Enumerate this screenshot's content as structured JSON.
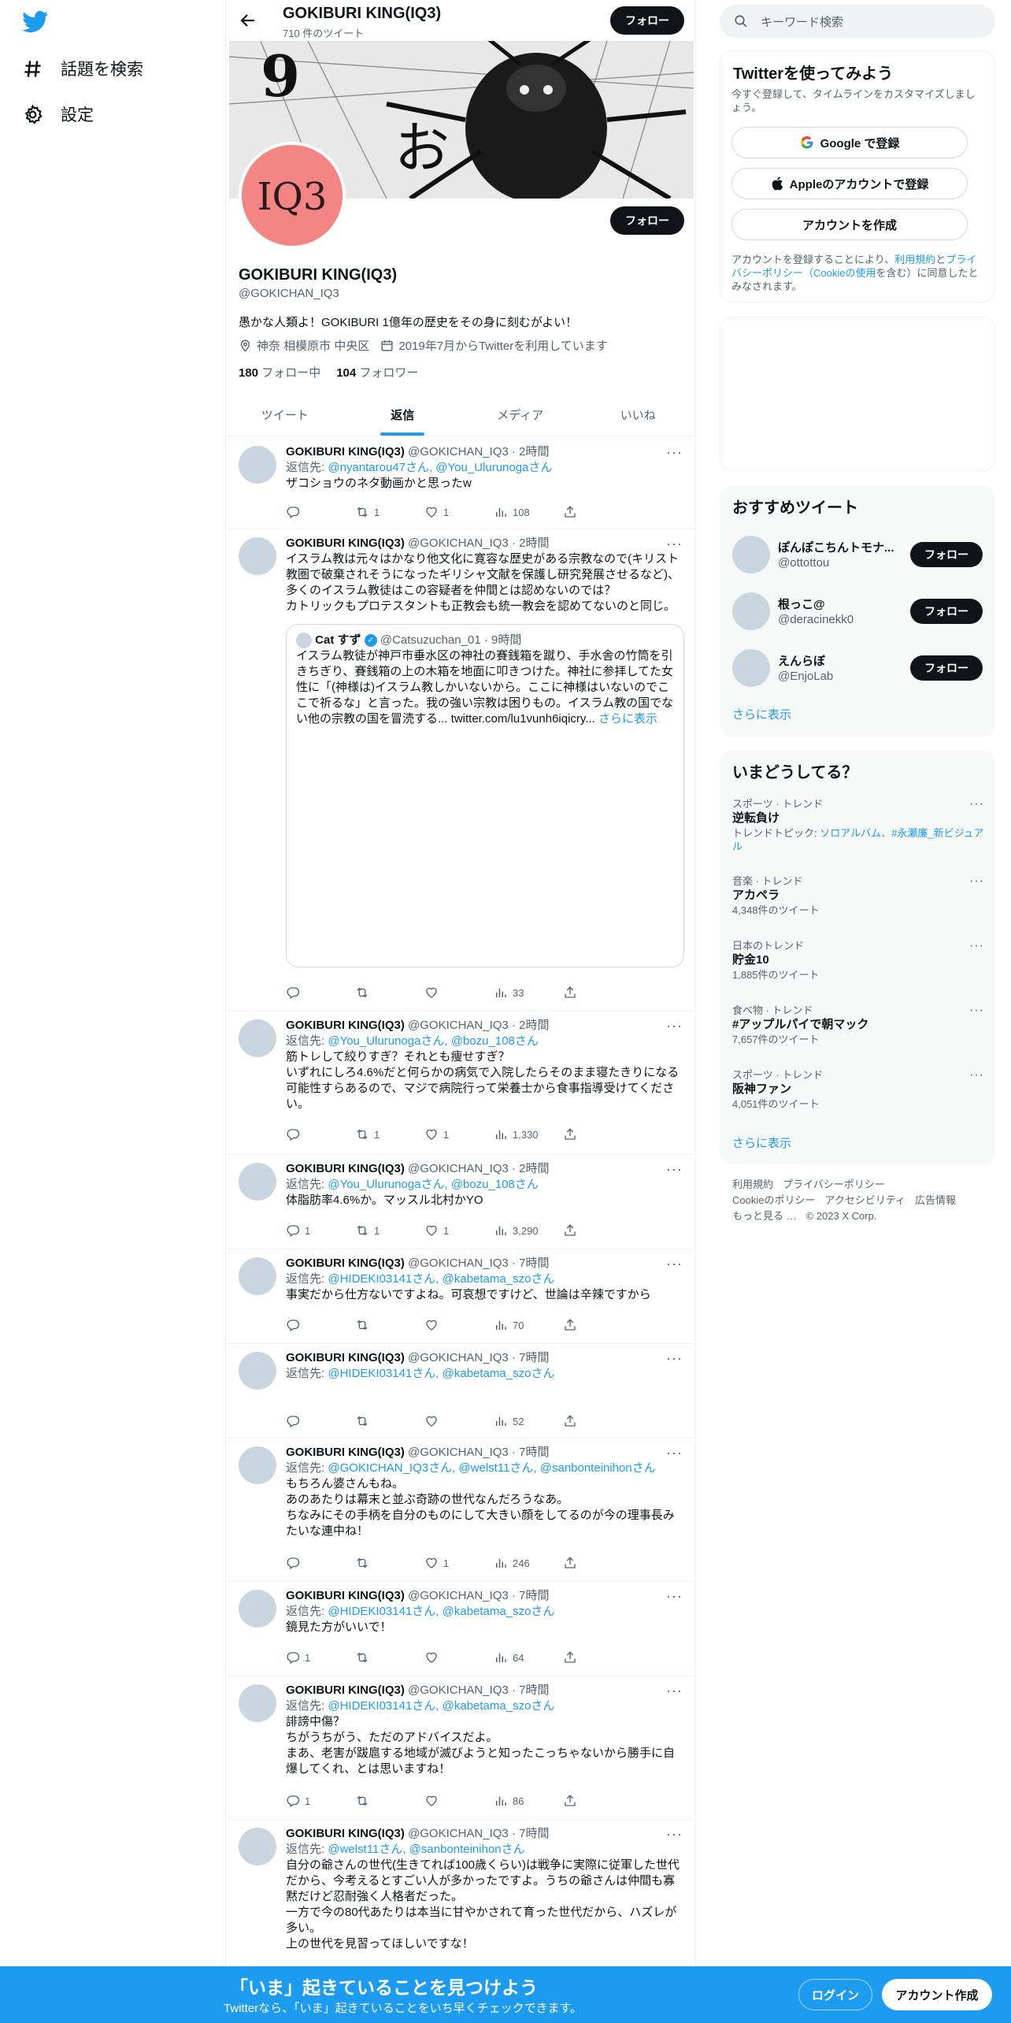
{
  "nav": {
    "explore_label": "話題を検索",
    "settings_label": "設定"
  },
  "header": {
    "title": "GOKIBURI KING(IQ3)",
    "tweet_count": "710 件のツイート",
    "follow_label": "フォロー"
  },
  "profile": {
    "avatar_text": "IQ3",
    "name": "GOKIBURI KING(IQ3)",
    "handle": "@GOKICHAN_IQ3",
    "bio": "愚かな人類よ！GOKIBURI 1億年の歴史をその身に刻むがよい！",
    "location": "神奈 相模原市 中央区",
    "joined": "2019年7月からTwitterを利用しています",
    "following_count": "180",
    "following_label": "フォロー中",
    "followers_count": "104",
    "followers_label": "フォロワー",
    "follow_label": "フォロー"
  },
  "tabs": [
    "ツイート",
    "返信",
    "メディア",
    "いいね"
  ],
  "tweets": [
    {
      "name": "GOKIBURI KING(IQ3)",
      "handle": "@GOKICHAN_IQ3 · 2時間",
      "reply_prefix": "返信先: ",
      "reply_to": "@nyantarou47さん, @You_Ulurunogaさん",
      "text": "ザコショウのネタ動画かと思ったw",
      "replies": "",
      "retweets": "1",
      "likes": "1",
      "views": "108"
    },
    {
      "name": "GOKIBURI KING(IQ3)",
      "handle": "@GOKICHAN_IQ3 · 2時間",
      "reply_prefix": "",
      "reply_to": "",
      "text": "イスラム教は元々はかなり他文化に寛容な歴史がある宗教なので(キリスト教圏で破棄されそうになったギリシャ文献を保護し研究発展させるなど)、多くのイスラム教徒はこの容疑者を仲間とは認めないのでは？\nカトリックもプロテスタントも正教会も統一教会を認めてないのと同じ。",
      "replies": "",
      "retweets": "",
      "likes": "",
      "views": "33",
      "quote": {
        "name": "Cat すず",
        "handle": "@Catsuzuchan_01 · 9時間",
        "text": "イスラム教徒が神戸市垂水区の神社の賽銭箱を蹴り、手水舎の竹筒を引きちぎり、賽銭箱の上の木箱を地面に叩きつけた。神社に参拝してた女性に「(神様は)イスラム教しかいないから。ここに神様はいないのでここで祈るな」と言った。我の強い宗教は困りもの。イスラム教の国でない他の宗教の国を冒涜する... twitter.com/lu1vunh6iqicry...",
        "more": "さらに表示"
      }
    },
    {
      "name": "GOKIBURI KING(IQ3)",
      "handle": "@GOKICHAN_IQ3 · 2時間",
      "reply_prefix": "返信先: ",
      "reply_to": "@You_Ulurunogaさん, @bozu_108さん",
      "text": "筋トレして絞りすぎ？それとも痩せすぎ？\nいずれにしろ4.6%だと何らかの病気で入院したらそのまま寝たきりになる可能性すらあるので、マジで病院行って栄養士から食事指導受けてください。",
      "replies": "",
      "retweets": "1",
      "likes": "1",
      "views": "1,330"
    },
    {
      "name": "GOKIBURI KING(IQ3)",
      "handle": "@GOKICHAN_IQ3 · 2時間",
      "reply_prefix": "返信先: ",
      "reply_to": "@You_Ulurunogaさん, @bozu_108さん",
      "text": "体脂肪率4.6%か。マッスル北村かYO",
      "replies": "1",
      "retweets": "1",
      "likes": "1",
      "views": "3,290"
    },
    {
      "name": "GOKIBURI KING(IQ3)",
      "handle": "@GOKICHAN_IQ3 · 7時間",
      "reply_prefix": "返信先: ",
      "reply_to": "@HIDEKI03141さん, @kabetama_szoさん",
      "text": "事実だから仕方ないですよね。可哀想ですけど、世論は辛辣ですから",
      "replies": "",
      "retweets": "",
      "likes": "",
      "views": "70"
    },
    {
      "name": "GOKIBURI KING(IQ3)",
      "handle": "@GOKICHAN_IQ3 · 7時間",
      "reply_prefix": "返信先: ",
      "reply_to": "@HIDEKI03141さん, @kabetama_szoさん",
      "text": "",
      "replies": "",
      "retweets": "",
      "likes": "",
      "views": "52"
    },
    {
      "name": "GOKIBURI KING(IQ3)",
      "handle": "@GOKICHAN_IQ3 · 7時間",
      "reply_prefix": "返信先: ",
      "reply_to": "@GOKICHAN_IQ3さん, @welst11さん, @sanbonteinihonさん",
      "text": "もちろん婆さんもね。\nあのあたりは幕末と並ぶ奇跡の世代なんだろうなあ。\nちなみにその手柄を自分のものにして大きい顔をしてるのが今の理事長みたいな連中ね！",
      "replies": "",
      "retweets": "",
      "likes": "1",
      "views": "246"
    },
    {
      "name": "GOKIBURI KING(IQ3)",
      "handle": "@GOKICHAN_IQ3 · 7時間",
      "reply_prefix": "返信先: ",
      "reply_to": "@HIDEKI03141さん, @kabetama_szoさん",
      "text": "鏡見た方がいいで！",
      "replies": "1",
      "retweets": "",
      "likes": "",
      "views": "64"
    },
    {
      "name": "GOKIBURI KING(IQ3)",
      "handle": "@GOKICHAN_IQ3 · 7時間",
      "reply_prefix": "返信先: ",
      "reply_to": "@HIDEKI03141さん, @kabetama_szoさん",
      "text": "誹謗中傷？\nちがうちがう、ただのアドバイスだよ。\nまあ、老害が跋扈する地域が滅びようと知ったこっちゃないから勝手に自爆してくれ、とは思いますね！",
      "replies": "1",
      "retweets": "",
      "likes": "",
      "views": "86"
    },
    {
      "name": "GOKIBURI KING(IQ3)",
      "handle": "@GOKICHAN_IQ3 · 7時間",
      "reply_prefix": "返信先: ",
      "reply_to": "@welst11さん, @sanbonteinihonさん",
      "text": "自分の爺さんの世代(生きてれば100歳くらい)は戦争に実際に従軍した世代だから、今考えるとすごい人が多かったですよ。うちの爺さんは仲間も寡黙だけど忍耐強く人格者だった。\n一方で今の80代あたりは本当に甘やかされて育った世代だから、ハズレが多い。\n上の世代を見習ってほしいですな！",
      "replies": "",
      "retweets": "",
      "likes": "",
      "views": ""
    }
  ],
  "right": {
    "search_placeholder": "キーワード検索",
    "signup_title": "Twitterを使ってみよう",
    "signup_sub": "今すぐ登録して、タイムラインをカスタマイズしましょう。",
    "google_btn": "Google で登録",
    "apple_btn": "Appleのアカウントで登録",
    "create_btn": "アカウントを作成",
    "terms_1": "アカウントを登録することにより、",
    "terms_link1": "利用規約",
    "terms_2": "と",
    "terms_link2": "プライバシーポリシー（Cookieの使用",
    "terms_3": "を含む）に同意したとみなされます。",
    "rec_title": "おすすめツイート",
    "recs": [
      {
        "name": "ぽんぽこちんトモナ...",
        "handle": "@ottottou"
      },
      {
        "name": "根っこ@",
        "handle": "@deracinekk0"
      },
      {
        "name": "えんらぼ",
        "handle": "@EnjoLab"
      }
    ],
    "follow_label": "フォロー",
    "show_more": "さらに表示",
    "trends_title": "いまどうしてる？",
    "trends": [
      {
        "cat": "スポーツ · トレンド",
        "name": "逆転負け",
        "extra_prefix": "トレンドトピック: ",
        "extra": "ソロアルバム、#永瀬廉_新ビジュアル",
        "count": ""
      },
      {
        "cat": "音楽 · トレンド",
        "name": "アカペラ",
        "extra_prefix": "",
        "extra": "",
        "count": "4,348件のツイート"
      },
      {
        "cat": "日本のトレンド",
        "name": "貯金10",
        "extra_prefix": "",
        "extra": "",
        "count": "1,885件のツイート"
      },
      {
        "cat": "食べ物 · トレンド",
        "name": "#アップルパイで朝マック",
        "extra_prefix": "",
        "extra": "",
        "count": "7,657件のツイート"
      },
      {
        "cat": "スポーツ · トレンド",
        "name": "阪神ファン",
        "extra_prefix": "",
        "extra": "",
        "count": "4,051件のツイート"
      }
    ],
    "footer": [
      "利用規約",
      "プライバシーポリシー",
      "Cookieのポリシー",
      "アクセシビリティ",
      "広告情報",
      "もっと見る …",
      "© 2023 X Corp."
    ]
  },
  "bottom": {
    "title": "「いま」起きていることを見つけよう",
    "sub": "Twitterなら、「いま」起きていることをいち早くチェックできます。",
    "login": "ログイン",
    "signup": "アカウント作成"
  },
  "colors": {
    "accent": "#1d9bf0",
    "text": "#0f1419",
    "muted": "#536471",
    "avatar": "#f38585"
  }
}
